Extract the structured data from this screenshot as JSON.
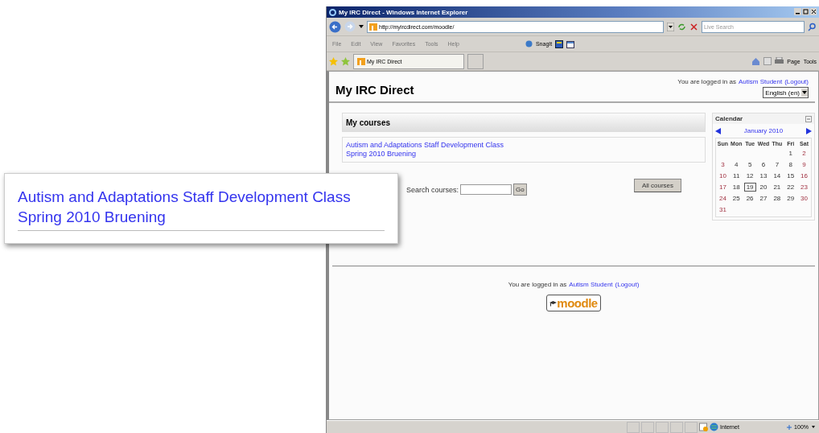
{
  "window": {
    "title": "My IRC Direct - Windows Internet Explorer",
    "address": "http://myircdirect.com/moodle/",
    "search_placeholder": "Live Search"
  },
  "menu": [
    "File",
    "Edit",
    "View",
    "Favorites",
    "Tools",
    "Help"
  ],
  "toolbar": {
    "snagit": "SnagIt"
  },
  "tab": {
    "label": "My IRC Direct",
    "selected": true
  },
  "commands": [
    "Page",
    "Tools"
  ],
  "page": {
    "site_name": "My IRC Direct",
    "login": {
      "prefix": "You are logged in as",
      "user": "Autism Student",
      "logout": "(Logout)"
    },
    "language": "English (en)",
    "my_courses": {
      "title": "My courses",
      "courses": [
        {
          "lines": [
            "Autism and Adaptations Staff Development Class",
            "Spring 2010 Bruening"
          ]
        }
      ]
    },
    "search": {
      "label": "Search courses:",
      "button": "Go"
    },
    "all_courses": "All courses",
    "calendar": {
      "title": "Calendar",
      "month": "January 2010",
      "weekdays": [
        "Sun",
        "Mon",
        "Tue",
        "Wed",
        "Thu",
        "Fri",
        "Sat"
      ],
      "weeks": [
        {
          "kind": "lead",
          "days": [
            {
              "day": "1",
              "weekend": false,
              "today": false
            },
            {
              "day": "2",
              "weekend": true,
              "today": false
            }
          ]
        },
        {
          "kind": "full",
          "days": [
            {
              "day": "3",
              "weekend": true,
              "today": false
            },
            {
              "day": "4",
              "weekend": false,
              "today": false
            },
            {
              "day": "5",
              "weekend": false,
              "today": false
            },
            {
              "day": "6",
              "weekend": false,
              "today": false
            },
            {
              "day": "7",
              "weekend": false,
              "today": false
            },
            {
              "day": "8",
              "weekend": false,
              "today": false
            },
            {
              "day": "9",
              "weekend": true,
              "today": false
            }
          ]
        },
        {
          "kind": "full",
          "days": [
            {
              "day": "10",
              "weekend": true,
              "today": false
            },
            {
              "day": "11",
              "weekend": false,
              "today": false
            },
            {
              "day": "12",
              "weekend": false,
              "today": false
            },
            {
              "day": "13",
              "weekend": false,
              "today": false
            },
            {
              "day": "14",
              "weekend": false,
              "today": false
            },
            {
              "day": "15",
              "weekend": false,
              "today": false
            },
            {
              "day": "16",
              "weekend": true,
              "today": false
            }
          ]
        },
        {
          "kind": "full",
          "days": [
            {
              "day": "17",
              "weekend": true,
              "today": false
            },
            {
              "day": "18",
              "weekend": false,
              "today": false
            },
            {
              "day": "19",
              "weekend": false,
              "today": true
            },
            {
              "day": "20",
              "weekend": false,
              "today": false
            },
            {
              "day": "21",
              "weekend": false,
              "today": false
            },
            {
              "day": "22",
              "weekend": false,
              "today": false
            },
            {
              "day": "23",
              "weekend": true,
              "today": false
            }
          ]
        },
        {
          "kind": "full",
          "days": [
            {
              "day": "24",
              "weekend": true,
              "today": false
            },
            {
              "day": "25",
              "weekend": false,
              "today": false
            },
            {
              "day": "26",
              "weekend": false,
              "today": false
            },
            {
              "day": "27",
              "weekend": false,
              "today": false
            },
            {
              "day": "28",
              "weekend": false,
              "today": false
            },
            {
              "day": "29",
              "weekend": false,
              "today": false
            },
            {
              "day": "30",
              "weekend": true,
              "today": false
            }
          ]
        },
        {
          "kind": "full",
          "days": [
            {
              "day": "31",
              "weekend": true,
              "today": false
            }
          ]
        }
      ]
    },
    "footer_login": {
      "prefix": "You are logged in as",
      "user": "Autism Student",
      "logout": "(Logout)"
    },
    "logo": "moodle"
  },
  "status": {
    "zone": "Internet",
    "zoom": "100%"
  },
  "callout": {
    "lines": [
      "Autism and Adaptations Staff Development Class",
      "Spring 2010 Bruening"
    ]
  }
}
